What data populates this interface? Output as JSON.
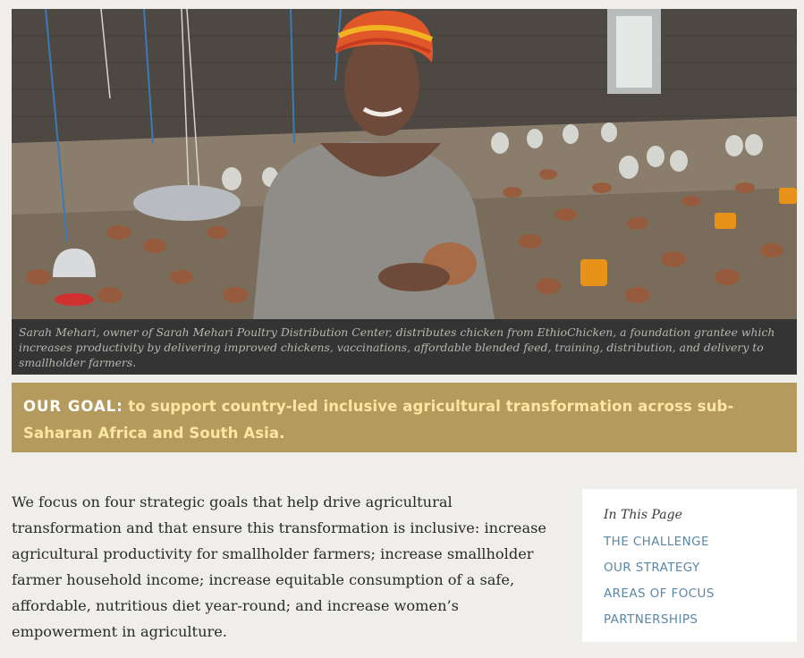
{
  "hero": {
    "image_desc": "photo-poultry-farmer",
    "caption": "Sarah Mehari, owner of Sarah Mehari Poultry Distribution Center, distributes chicken from EthioChicken, a foundation grantee which increases productivity by delivering improved chickens, vaccinations, affordable blended feed, training, distribution, and delivery to smallholder farmers."
  },
  "goal": {
    "label": "OUR GOAL:",
    "text": "to support country-led inclusive agricultural transformation across sub-Saharan Africa and South Asia."
  },
  "intro": "We focus on four strategic goals that help drive agricultural transformation and that ensure this transformation is inclusive: increase agricultural productivity for smallholder farmers; increase smallholder farmer household income; increase equitable consumption of a safe, affordable, nutritious diet year-round; and increase women’s empowerment in agriculture.",
  "toc": {
    "title": "In This Page",
    "links": [
      "THE CHALLENGE",
      "OUR STRATEGY",
      "AREAS OF FOCUS",
      "PARTNERSHIPS"
    ]
  },
  "colors": {
    "goal_bg": "#b59a5d",
    "goal_text": "#fbe7a3",
    "link": "#5b87a6",
    "caption_bg": "#343434"
  }
}
